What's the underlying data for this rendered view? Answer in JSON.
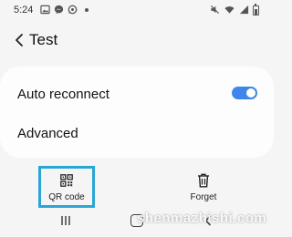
{
  "status_bar": {
    "time": "5:24",
    "left_icons": [
      "image-icon",
      "messenger-icon",
      "whatsapp-icon",
      "dot-icon"
    ],
    "right_icons": [
      "mute-icon",
      "wifi-icon",
      "signal-icon",
      "battery-icon"
    ]
  },
  "header": {
    "back_icon": "chevron-left-icon",
    "title": "Test"
  },
  "settings": {
    "auto_reconnect": {
      "label": "Auto reconnect",
      "enabled": true
    },
    "advanced": {
      "label": "Advanced"
    }
  },
  "actions": {
    "qr_code": {
      "label": "QR code",
      "icon": "qr-code-icon"
    },
    "forget": {
      "label": "Forget",
      "icon": "trash-icon"
    }
  },
  "nav_bar": {
    "icons": [
      "recent-apps-icon",
      "home-icon",
      "back-icon"
    ]
  },
  "watermark": "shenmazhishi.com",
  "colors": {
    "background": "#f5f5f5",
    "card": "#fdfdfd",
    "toggle_on": "#3e86e9",
    "highlight_border": "#2aa6d6"
  }
}
